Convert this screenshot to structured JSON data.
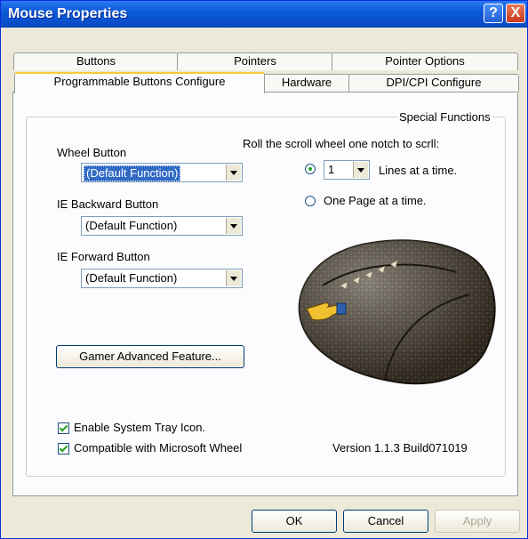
{
  "window": {
    "title": "Mouse Properties",
    "help_label": "?",
    "close_label": "X"
  },
  "tabs": {
    "row1": [
      "Buttons",
      "Pointers",
      "Pointer Options"
    ],
    "row2": [
      "Programmable Buttons Configure",
      "Hardware",
      "DPI/CPI Configure"
    ],
    "active": "Programmable Buttons Configure"
  },
  "special": {
    "group_label": "Special Functions",
    "scroll_label": "Roll the scroll wheel one notch to scrll:",
    "lines_value": "1",
    "lines_label": "Lines at a time.",
    "page_label": "One Page at a time.",
    "lines_selected": true
  },
  "buttons": {
    "wheel_label": "Wheel Button",
    "wheel_value": "(Default Function)",
    "back_label": "IE Backward Button",
    "back_value": "(Default Function)",
    "forward_label": "IE Forward Button",
    "forward_value": "(Default Function)",
    "gamer_label": "Gamer Advanced Feature..."
  },
  "options": {
    "tray_label": "Enable System Tray Icon.",
    "tray_checked": true,
    "ms_wheel_label": "Compatible with Microsoft Wheel",
    "ms_wheel_checked": true,
    "version": "Version 1.1.3 Build071019"
  },
  "footer": {
    "ok_label": "OK",
    "cancel_label": "Cancel",
    "apply_label": "Apply"
  },
  "colors": {
    "title_blue": "#0b5ad8",
    "selection_blue": "#316ac5",
    "mouse_body": "#3a3226",
    "mouse_accent": "#c9b48a"
  }
}
